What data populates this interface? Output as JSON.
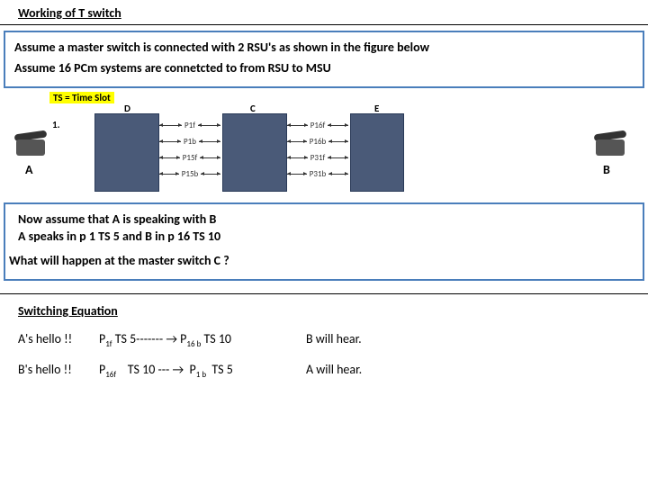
{
  "title": "Working of T switch",
  "intro": {
    "line1": "Assume a master switch is connected with 2 RSU's  as shown in the figure below",
    "line2": "Assume 16 PCm systems are connetcted to from RSU to MSU"
  },
  "diagram": {
    "ts_label": "TS = Time Slot",
    "num": "1.",
    "col_D": "D",
    "col_C": "C",
    "col_E": "E",
    "left_endpoint": "A",
    "right_endpoint": "B",
    "links_left": [
      "P1f",
      "P1b",
      "P15f",
      "P15b"
    ],
    "links_right": [
      "P16f",
      "P16b",
      "P31f",
      "P31b"
    ]
  },
  "scenario": {
    "line1": "Now assume that A is speaking with B",
    "line2": "A speaks in p 1 TS 5 and B in p 16 TS 10",
    "question": "What will happen at the master switch C ?"
  },
  "equation": {
    "heading": "Switching Equation",
    "row1": {
      "who": "A's hello !!",
      "expr": "P 1f  TS 5------- → P 16 b TS 10",
      "result": "B will hear."
    },
    "row2": {
      "who": "B's hello !!",
      "expr": "P 16f    TS 10 --- →  P 1 b  TS 5",
      "result": "A will hear."
    }
  }
}
